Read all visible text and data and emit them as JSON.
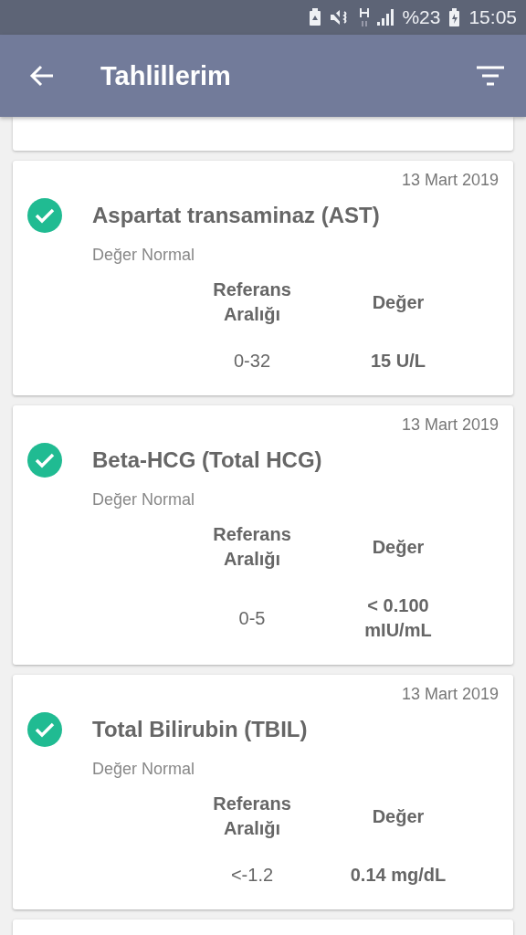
{
  "status_bar": {
    "battery_percent": "%23",
    "time": "15:05"
  },
  "app_bar": {
    "title": "Tahlillerim"
  },
  "results": [
    {
      "date": "13 Mart 2019",
      "name": "Aspartat transaminaz (AST)",
      "normal": true,
      "status": "Değer Normal",
      "reference_header": "Referans Aralığı",
      "value_header": "Değer",
      "reference": "0-32",
      "value": "15 U/L"
    },
    {
      "date": "13 Mart 2019",
      "name": "Beta-HCG (Total HCG)",
      "normal": true,
      "status": "Değer Normal",
      "reference_header": "Referans Aralığı",
      "value_header": "Değer",
      "reference": "0-5",
      "value": "< 0.100 mIU/mL"
    },
    {
      "date": "13 Mart 2019",
      "name": "Total Bilirubin (TBIL)",
      "normal": true,
      "status": "Değer Normal",
      "reference_header": "Referans Aralığı",
      "value_header": "Değer",
      "reference": "<-1.2",
      "value": "0.14 mg/dL"
    }
  ]
}
